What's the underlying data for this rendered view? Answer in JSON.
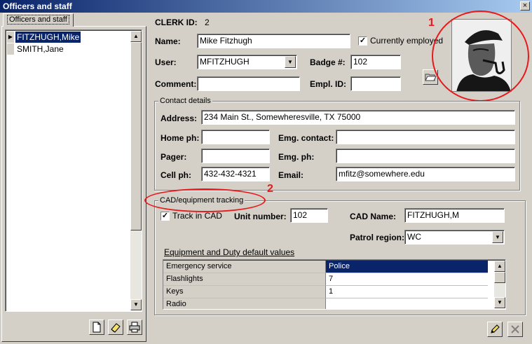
{
  "window": {
    "title": "Officers and staff",
    "close_glyph": "×"
  },
  "left_panel": {
    "tab_label": "Officers and staff",
    "list": [
      {
        "name": "FITZHUGH,Mike",
        "selected": true
      },
      {
        "name": "SMITH,Jane",
        "selected": false
      }
    ],
    "row_indicator": "▶",
    "buttons": [
      {
        "name": "new-record-button",
        "icon": "new-document-icon"
      },
      {
        "name": "clear-record-button",
        "icon": "eraser-icon"
      },
      {
        "name": "print-button",
        "icon": "printer-icon"
      }
    ]
  },
  "clerk": {
    "id_label": "CLERK ID:",
    "id_value": "2"
  },
  "form": {
    "name_label": "Name:",
    "name_value": "Mike Fitzhugh",
    "employed_label": "Currently employed",
    "employed_checked": true,
    "user_label": "User:",
    "user_value": "MFITZHUGH",
    "badge_label": "Badge #:",
    "badge_value": "102",
    "comment_label": "Comment:",
    "comment_value": "",
    "empl_id_label": "Empl. ID:",
    "empl_id_value": ""
  },
  "contact": {
    "title": "Contact details",
    "address_label": "Address:",
    "address_value": "234 Main St., Somewheresville, TX 75000",
    "home_ph_label": "Home ph:",
    "home_ph_value": "",
    "emg_contact_label": "Emg. contact:",
    "emg_contact_value": "",
    "pager_label": "Pager:",
    "pager_value": "",
    "emg_ph_label": "Emg. ph:",
    "emg_ph_value": "",
    "cell_ph_label": "Cell ph:",
    "cell_ph_value": "432-432-4321",
    "email_label": "Email:",
    "email_value": "mfitz@somewhere.edu"
  },
  "cad": {
    "title": "CAD/equipment tracking",
    "track_label": "Track in CAD",
    "track_checked": true,
    "unit_label": "Unit number:",
    "unit_value": "102",
    "cad_name_label": "CAD Name:",
    "cad_name_value": "FITZHUGH,M",
    "patrol_label": "Patrol region:",
    "patrol_value": "WC",
    "equipment_title": "Equipment and Duty default values",
    "equipment": [
      {
        "key": "Emergency service",
        "value": "Police",
        "selected": true
      },
      {
        "key": "Flashlights",
        "value": "7",
        "selected": false
      },
      {
        "key": "Keys",
        "value": "1",
        "selected": false
      },
      {
        "key": "Radio",
        "value": "",
        "selected": false
      }
    ]
  },
  "annotations": [
    {
      "label": "1"
    },
    {
      "label": "2"
    }
  ],
  "colors": {
    "annotation": "#e8191c",
    "selection": "#0a246a",
    "face": "#d4d0c8"
  },
  "icons": {
    "checkmark": "✓",
    "arrow_up": "▲",
    "arrow_down": "▼",
    "photo_browse": "folder-icon",
    "edit": "pencil-icon",
    "cancel": "cancel-x-icon"
  }
}
